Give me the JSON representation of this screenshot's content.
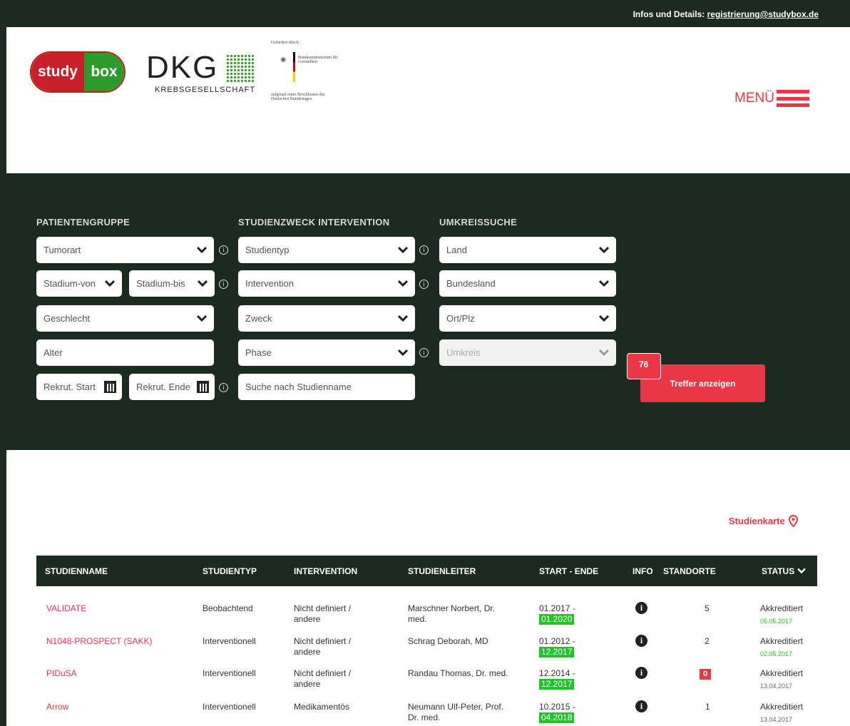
{
  "topbar": {
    "info_label": "Infos und Details:",
    "email": "registrierung@studybox.de"
  },
  "logos": {
    "studybox_left": "study",
    "studybox_right": "box",
    "dkg_main": "DKG",
    "dkg_sub": "KREBSGESELLSCHAFT",
    "bmg_top": "Gefördert durch:",
    "bmg_ministry": "Bundesministerium für Gesundheit",
    "bmg_bottom": "aufgrund eines Beschlusses des Deutschen Bundestages"
  },
  "menu": {
    "label": "MENÜ"
  },
  "filters": {
    "group1_title": "PATIENTENGRUPPE",
    "group2_title": "STUDIENZWECK INTERVENTION",
    "group3_title": "UMKREISSUCHE",
    "tumorart": "Tumorart",
    "stadium_von": "Stadium-von",
    "stadium_bis": "Stadium-bis",
    "geschlecht": "Geschlecht",
    "alter_placeholder": "Alter",
    "rekrut_start": "Rekrut. Start",
    "rekrut_ende": "Rekrut. Ende",
    "studientyp": "Studientyp",
    "intervention": "Intervention",
    "zweck": "Zweck",
    "phase": "Phase",
    "suche_placeholder": "Suche nach Studienname",
    "land": "Land",
    "bundesland": "Bundesland",
    "ort": "Ort/Plz",
    "umkreis": "Umkreis",
    "count": "76",
    "treffer": "Treffer anzeigen"
  },
  "results": {
    "map_link": "Studienkarte",
    "columns": {
      "name": "STUDIENNAME",
      "typ": "STUDIENTYP",
      "intervention": "INTERVENTION",
      "leiter": "STUDIENLEITER",
      "dates": "START - ENDE",
      "info": "INFO",
      "standorte": "STANDORTE",
      "status": "STATUS"
    },
    "rows": [
      {
        "name": "VALIDATE",
        "typ": "Beobachtend",
        "intervention_1": "Nicht definiert /",
        "intervention_2": "andere",
        "leiter_1": "Marschner Norbert, Dr.",
        "leiter_2": "med.",
        "start": "01.2017 -",
        "end": "01.2020",
        "standorte": "5",
        "status": "Akkreditiert",
        "date": "05.05.2017"
      },
      {
        "name": "N1048-PROSPECT (SAKK)",
        "typ": "Interventionell",
        "intervention_1": "Nicht definiert /",
        "intervention_2": "andere",
        "leiter_1": "Schrag Deborah, MD",
        "leiter_2": "",
        "start": "01.2012 -",
        "end": "12.2017",
        "standorte": "2",
        "status": "Akkreditiert",
        "date": "02.05.2017"
      },
      {
        "name": "PIDuSA",
        "typ": "Interventionell",
        "intervention_1": "Nicht definiert /",
        "intervention_2": "andere",
        "leiter_1": "Randau Thomas, Dr. med.",
        "leiter_2": "",
        "start": "12.2014 -",
        "end": "12.2017",
        "standorte": "0",
        "status": "Akkreditiert",
        "date": "13.04.2017"
      },
      {
        "name": "Arrow",
        "typ": "Interventionell",
        "intervention_1": "Medikamentös",
        "intervention_2": "",
        "leiter_1": "Neumann Ulf-Peter, Prof.",
        "leiter_2": "Dr. med.",
        "start": "10.2015 -",
        "end": "04.2018",
        "standorte": "1",
        "status": "Akkreditiert",
        "date": "13.04.2017"
      }
    ]
  },
  "colors": {
    "dark": "#1c2b22",
    "accent": "#e83845",
    "green": "#22c22a"
  }
}
